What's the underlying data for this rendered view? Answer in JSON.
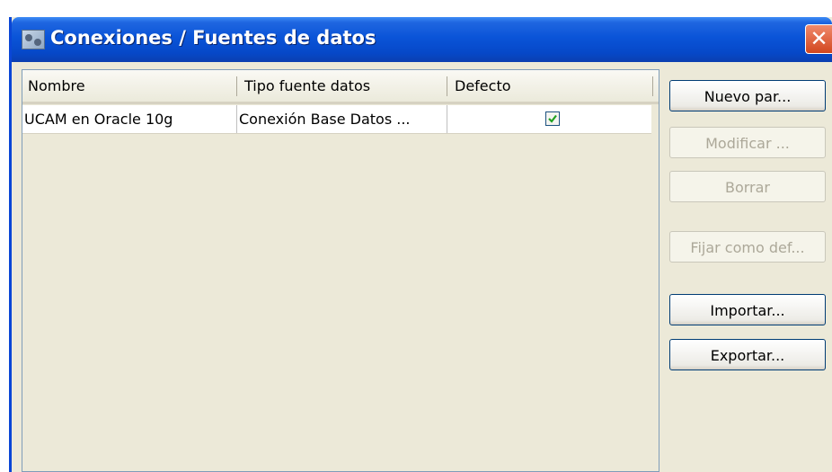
{
  "window": {
    "title": "Conexiones / Fuentes de datos",
    "close_glyph": "✕",
    "title_icon": "data-sources-icon"
  },
  "table": {
    "columns": [
      "Nombre",
      "Tipo fuente datos",
      "Defecto"
    ],
    "rows": [
      {
        "name": "UCAM en Oracle 10g",
        "type": "Conexión Base Datos ...",
        "default": true
      }
    ]
  },
  "buttons": {
    "new": "Nuevo par...",
    "modify": "Modificar ...",
    "delete": "Borrar",
    "set_default": "Fijar como def...",
    "import": "Importar...",
    "export": "Exportar..."
  },
  "colors": {
    "titlebar": "#0a54d8",
    "close_button": "#d2461e",
    "check": "#21a121",
    "dialog_bg": "#ece9d8"
  }
}
